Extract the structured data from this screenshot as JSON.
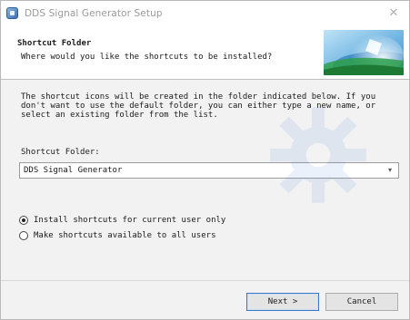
{
  "window": {
    "title": "DDS Signal Generator Setup"
  },
  "header": {
    "title": "Shortcut Folder",
    "subtitle": "Where would you like the shortcuts to be installed?"
  },
  "body": {
    "description_lines": [
      "The shortcut icons will be created in the folder indicated below. If you",
      "don't want to use the default folder, you can either type a new name, or",
      "select an existing folder from the list."
    ],
    "folder_label": "Shortcut Folder:",
    "folder_value": "DDS Signal Generator"
  },
  "options": [
    {
      "label": "Install shortcuts for current user only",
      "selected": true
    },
    {
      "label": "Make shortcuts available to all users",
      "selected": false
    }
  ],
  "buttons": {
    "next": "Next >",
    "cancel": "Cancel"
  },
  "icons": {
    "app": "installer-icon",
    "close": "close-icon",
    "dropdown": "chevron-down-icon",
    "banner": "setup-banner-graphic",
    "watermark": "gear-icon"
  }
}
